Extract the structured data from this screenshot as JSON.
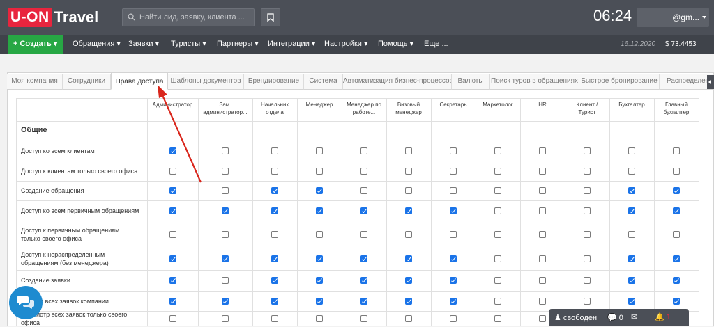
{
  "header": {
    "logo_box": "U-ON",
    "logo_text": "Travel",
    "search_placeholder": "Найти лид, заявку, клиента ...",
    "clock": "06:24",
    "user": "@gm..."
  },
  "nav": {
    "create": "+ Создать",
    "items": [
      "Обращения",
      "Заявки",
      "Туристы",
      "Партнеры",
      "Интеграции",
      "Настройки",
      "Помощь",
      "Еще ..."
    ],
    "date": "16.12.2020",
    "rate": "$  73.4453"
  },
  "tabs": [
    "Моя компания",
    "Сотрудники",
    "Права доступа",
    "Шаблоны документов",
    "Брендирование",
    "Система",
    "Автоматизация бизнес-процессов",
    "Валюты",
    "Поиск туров в обращениях",
    "Быстрое бронирование",
    "Распределение"
  ],
  "active_tab": "Права доступа",
  "columns": [
    "Администратор",
    "Зам. администратор...",
    "Начальник отдела",
    "Менеджер",
    "Менеджер по работе...",
    "Визовый менеджер",
    "Секретарь",
    "Маркетолог",
    "HR",
    "Клиент / Турист",
    "Бухгалтер",
    "Главный бухгалтер"
  ],
  "section": "Общие",
  "rows": [
    {
      "label": "Доступ ко всем клиентам",
      "checks": [
        1,
        0,
        0,
        0,
        0,
        0,
        0,
        0,
        0,
        0,
        0,
        0
      ]
    },
    {
      "label": "Доступ к клиентам только своего офиса",
      "checks": [
        0,
        0,
        0,
        0,
        0,
        0,
        0,
        0,
        0,
        0,
        0,
        0
      ]
    },
    {
      "label": "Создание обращения",
      "checks": [
        1,
        0,
        1,
        1,
        0,
        0,
        0,
        0,
        0,
        0,
        1,
        1
      ]
    },
    {
      "label": "Доступ ко всем первичным обращениям",
      "checks": [
        1,
        1,
        1,
        1,
        1,
        1,
        1,
        0,
        0,
        0,
        1,
        1
      ]
    },
    {
      "label": "Доступ к первичным обращениям только своего офиса",
      "checks": [
        0,
        0,
        0,
        0,
        0,
        0,
        0,
        0,
        0,
        0,
        0,
        0
      ]
    },
    {
      "label": "Доступ к нераспределенным обращениям (без менеджера)",
      "checks": [
        1,
        1,
        1,
        1,
        1,
        1,
        1,
        0,
        0,
        0,
        1,
        1
      ]
    },
    {
      "label": "Создание заявки",
      "checks": [
        1,
        0,
        1,
        1,
        1,
        1,
        1,
        0,
        0,
        0,
        1,
        1
      ]
    },
    {
      "label": "...смотр всех заявок компании",
      "checks": [
        1,
        1,
        1,
        1,
        1,
        1,
        1,
        0,
        0,
        0,
        1,
        1
      ]
    },
    {
      "label": "Просмотр всех заявок только своего офиса",
      "checks": [
        0,
        0,
        0,
        0,
        0,
        0,
        0,
        0,
        0,
        0,
        0,
        0
      ]
    }
  ],
  "status": {
    "state": "свободен",
    "count_a": "0",
    "count_b": "1"
  }
}
